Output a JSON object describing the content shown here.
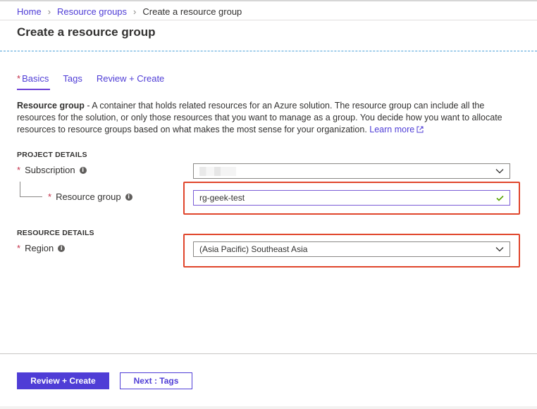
{
  "breadcrumb": {
    "home": "Home",
    "resource_groups": "Resource groups",
    "current": "Create a resource group"
  },
  "page": {
    "title": "Create a resource group"
  },
  "tabs": [
    {
      "label": "Basics",
      "required": true,
      "active": true
    },
    {
      "label": "Tags",
      "required": false,
      "active": false
    },
    {
      "label": "Review + Create",
      "required": false,
      "active": false
    }
  ],
  "description": {
    "term": "Resource group",
    "text": " - A container that holds related resources for an Azure solution. The resource group can include all the resources for the solution, or only those resources that you want to manage as a group. You decide how you want to allocate resources to resource groups based on what makes the most sense for your organization. ",
    "learn_more": "Learn more"
  },
  "project_details": {
    "heading": "PROJECT DETAILS",
    "subscription": {
      "label": "Subscription",
      "value": ""
    },
    "resource_group": {
      "label": "Resource group",
      "value": "rg-geek-test",
      "valid": true
    }
  },
  "resource_details": {
    "heading": "RESOURCE DETAILS",
    "region": {
      "label": "Region",
      "value": "(Asia Pacific) Southeast Asia"
    }
  },
  "footer": {
    "primary_button": "Review + Create",
    "secondary_button": "Next : Tags"
  },
  "colors": {
    "accent": "#4f3dd6",
    "required": "#c4314b",
    "highlight": "#e0452b",
    "valid": "#57a300"
  }
}
